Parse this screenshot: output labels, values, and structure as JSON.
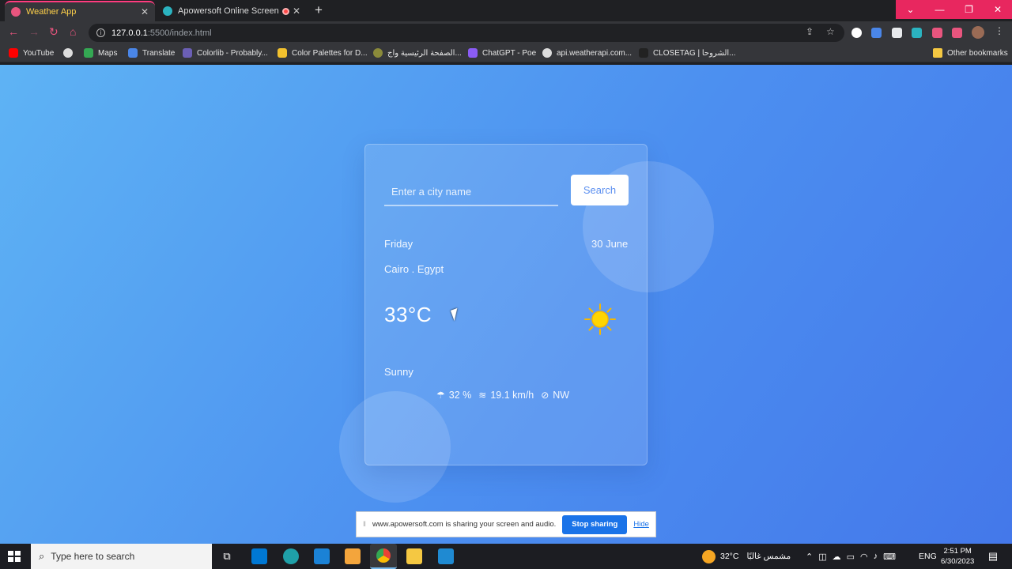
{
  "browser": {
    "tabs": [
      {
        "title": "Weather App",
        "active": true
      },
      {
        "title": "Apowersoft Online Screen Re",
        "active": false
      }
    ],
    "url_host": "127.0.0.1",
    "url_path": ":5500/index.html",
    "bookmarks": [
      "YouTube",
      "",
      "Maps",
      "Translate",
      "Colorlib - Probably...",
      "Color Palettes for D...",
      "الصفحة الرئيسية واج...",
      "ChatGPT - Poe",
      "api.weatherapi.com...",
      "CLOSETAG | الشروحا...",
      "Other bookmarks"
    ]
  },
  "weather": {
    "search_placeholder": "Enter a city name",
    "search_button": "Search",
    "day": "Friday",
    "date": "30 June",
    "location": "Cairo . Egypt",
    "temperature": "33",
    "temp_unit": "°C",
    "condition": "Sunny",
    "humidity": "32 %",
    "wind_speed": "19.1 km/h",
    "wind_direction": "NW",
    "condition_icon": "sun-icon"
  },
  "share_bar": {
    "message": "www.apowersoft.com is sharing your screen and audio.",
    "stop_label": "Stop sharing",
    "hide_label": "Hide"
  },
  "taskbar": {
    "search_placeholder": "Type here to search",
    "weather_temp": "32°C",
    "weather_text": "مشمس غالبًا",
    "language": "ENG",
    "time": "2:51 PM",
    "date": "6/30/2023"
  },
  "colors": {
    "accent": "#e8275f",
    "page_gradient_start": "#5eb3f4",
    "page_gradient_end": "#4478ea",
    "button_text": "#5b8ff0"
  }
}
